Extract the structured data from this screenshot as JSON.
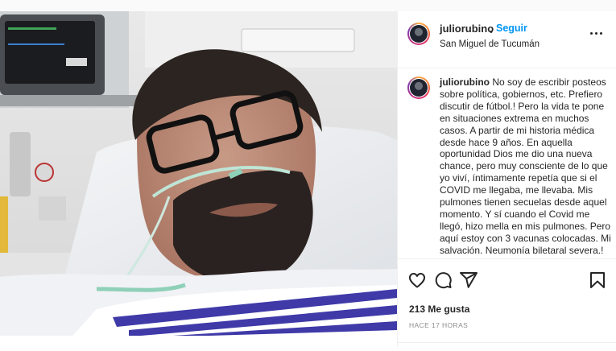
{
  "post": {
    "username": "juliorubino",
    "separator": "•",
    "follow_label": "Seguir",
    "location": "San Miguel de Tucumán",
    "caption_username": "juliorubino",
    "caption_text": "No soy de escribir posteos sobre política, gobiernos, etc. Prefiero discutir de fútbol.! Pero la vida te pone en situaciones extrema en muchos casos. A partir de mi historia médica desde hace 9 años. En aquella oportunidad Dios me dio una nueva chance, pero muy consciente de lo que yo viví, íntimamente repetía que si el COVID me llegaba, me llevaba. Mis pulmones tienen secuelas desde aquel momento. Y sí cuando el Covid me llegó, hizo mella en mis pulmones. Pero aquí estoy con 3 vacunas colocadas. Mi salvación. Neumonía biletaral severa.! Estoy asistido por un impecable sistema de",
    "likes": "213 Me gusta",
    "timestamp": "HACE 17 HORAS"
  },
  "icons": {
    "more": "more-options-icon",
    "like": "heart-icon",
    "comment": "comment-icon",
    "share": "share-icon",
    "save": "bookmark-icon"
  },
  "colors": {
    "accent": "#0095f6",
    "text": "#262626",
    "muted": "#8e8e8e",
    "border": "#efefef"
  }
}
